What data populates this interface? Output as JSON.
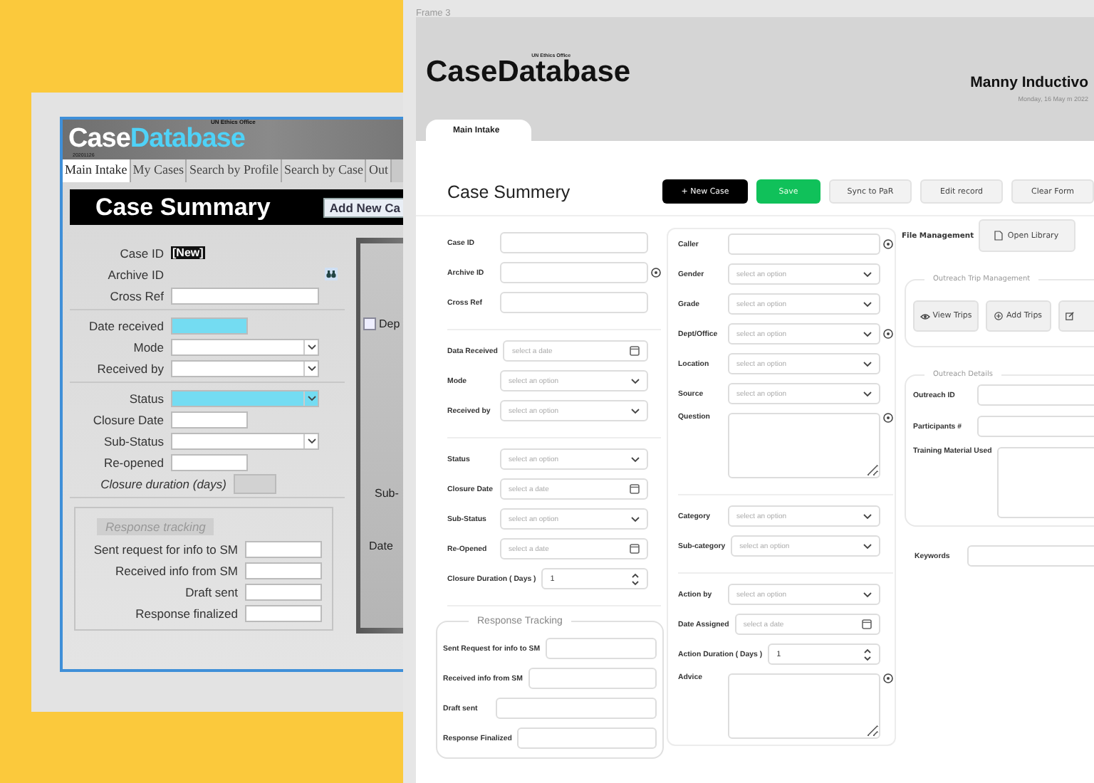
{
  "legacy_app": {
    "title_part_1": "Case",
    "title_part_2": "Database",
    "org": "UN Ethics Office",
    "build": "20201126",
    "tabs": [
      {
        "label": "Main Intake",
        "selected": true
      },
      {
        "label": "My Cases",
        "selected": false
      },
      {
        "label": "Search by Profile",
        "selected": false
      },
      {
        "label": "Search by Case",
        "selected": false
      },
      {
        "label": "Out",
        "selected": false
      }
    ],
    "section_title": "Case Summary",
    "add_button": "Add New Ca",
    "groups": [
      [
        {
          "label": "Case ID",
          "kind": "badge",
          "value": "[New]"
        },
        {
          "label": "Archive ID",
          "kind": "lookup"
        },
        {
          "label": "Cross Ref",
          "kind": "text"
        }
      ],
      [
        {
          "label": "Date received",
          "kind": "short",
          "highlight": true
        },
        {
          "label": "Mode",
          "kind": "select"
        },
        {
          "label": "Received by",
          "kind": "select"
        }
      ],
      [
        {
          "label": "Status",
          "kind": "select",
          "highlight": true
        },
        {
          "label": "Closure Date",
          "kind": "short"
        },
        {
          "label": "Sub-Status",
          "kind": "select"
        },
        {
          "label": "Re-opened",
          "kind": "short"
        },
        {
          "label": "Closure duration (days)",
          "kind": "readonly"
        }
      ]
    ],
    "response_group": {
      "legend": "Response tracking",
      "fields": [
        "Sent request for info to SM",
        "Received info from SM",
        "Draft sent",
        "Response finalized"
      ]
    },
    "side_panel": [
      {
        "label": "Dep",
        "kind": "checkbox",
        "checked": false
      },
      {
        "label": "Sub-",
        "kind": "text"
      },
      {
        "label": "Date",
        "kind": "text"
      }
    ]
  },
  "redesign": {
    "frame_label": "Frame 3",
    "title": "CaseDatabase",
    "org": "UN Ethics Office",
    "user_name": "Manny Inductivo",
    "date": "Monday, 16 May m 2022",
    "tabs": [
      {
        "label": "Main Intake",
        "selected": true
      }
    ],
    "section_title": "Case Summery",
    "buttons": [
      {
        "label": "+ New Case",
        "kind": "dark"
      },
      {
        "label": "Save",
        "kind": "success"
      },
      {
        "label": "Sync to PaR",
        "kind": "plain"
      },
      {
        "label": "Edit record",
        "kind": "plain"
      },
      {
        "label": "Clear Form",
        "kind": "plain"
      }
    ],
    "column_1": {
      "groups": [
        [
          {
            "label": "Case ID",
            "kind": "text"
          },
          {
            "label": "Archive ID",
            "kind": "text",
            "info": true
          },
          {
            "label": "Cross Ref",
            "kind": "text"
          }
        ],
        [
          {
            "label": "Data Received",
            "kind": "date",
            "placeholder": "select a date"
          },
          {
            "label": "Mode",
            "kind": "select",
            "placeholder": "select an option"
          },
          {
            "label": "Received by",
            "kind": "select",
            "placeholder": "select an option"
          }
        ],
        [
          {
            "label": "Status",
            "kind": "select",
            "placeholder": "select an option"
          },
          {
            "label": "Closure Date",
            "kind": "date",
            "placeholder": "select a date"
          },
          {
            "label": "Sub-Status",
            "kind": "select",
            "placeholder": "select an option"
          },
          {
            "label": "Re-Opened",
            "kind": "date",
            "placeholder": "select a date"
          },
          {
            "label": "Closure Duration ( Days )",
            "kind": "number",
            "value": "1"
          }
        ]
      ],
      "fieldset": {
        "legend": "Response Tracking",
        "fields": [
          {
            "label": "Sent Request for info to SM",
            "kind": "text"
          },
          {
            "label": "Received info from SM",
            "kind": "text"
          },
          {
            "label": "Draft sent",
            "kind": "text"
          },
          {
            "label": "Response Finalized",
            "kind": "text"
          }
        ]
      }
    },
    "column_2": {
      "groups": [
        [
          {
            "label": "Caller",
            "kind": "text",
            "info": true
          },
          {
            "label": "Gender",
            "kind": "select",
            "placeholder": "select an option"
          },
          {
            "label": "Grade",
            "kind": "select",
            "placeholder": "select an option"
          },
          {
            "label": "Dept/Office",
            "kind": "select",
            "placeholder": "select an option",
            "info": true
          },
          {
            "label": "Location",
            "kind": "select",
            "placeholder": "select an option"
          },
          {
            "label": "Source",
            "kind": "select",
            "placeholder": "select an option"
          },
          {
            "label": "Question",
            "kind": "textarea",
            "info": true
          }
        ],
        [
          {
            "label": "Category",
            "kind": "select",
            "placeholder": "select an option"
          },
          {
            "label": "Sub-category",
            "kind": "select",
            "placeholder": "select an option"
          }
        ],
        [
          {
            "label": "Action by",
            "kind": "select",
            "placeholder": "select an option"
          },
          {
            "label": "Date Assigned",
            "kind": "date",
            "placeholder": "select a date"
          },
          {
            "label": "Action Duration ( Days )",
            "kind": "number",
            "value": "1"
          },
          {
            "label": "Advice",
            "kind": "textarea",
            "info": true
          }
        ]
      ]
    },
    "column_3": {
      "file_label": "File Management",
      "file_button": "Open Library",
      "trips": {
        "legend": "Outreach Trip Management",
        "buttons": [
          {
            "label": "View Trips",
            "kind": "eye"
          },
          {
            "label": "Add Trips",
            "kind": "plus"
          },
          {
            "kind": "edit"
          }
        ]
      },
      "details": {
        "legend": "Outreach Details",
        "fields": [
          {
            "label": "Outreach ID",
            "kind": "text"
          },
          {
            "label": "Participants #",
            "kind": "text"
          },
          {
            "label": "Training Material Used",
            "kind": "textarea"
          }
        ]
      },
      "keywords": {
        "label": "Keywords",
        "kind": "text"
      }
    }
  }
}
